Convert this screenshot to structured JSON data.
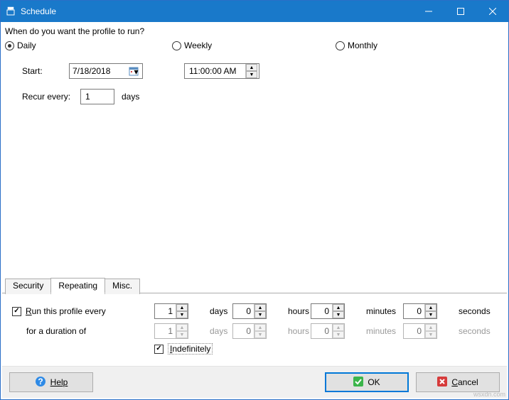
{
  "window": {
    "title": "Schedule"
  },
  "question": "When do you want the profile to run?",
  "frequency": {
    "daily": "Daily",
    "weekly": "Weekly",
    "monthly": "Monthly",
    "selected": "daily"
  },
  "start": {
    "label": "Start:",
    "date": "7/18/2018",
    "time": "11:00:00 AM"
  },
  "recur": {
    "label": "Recur every:",
    "value": "1",
    "unit": "days"
  },
  "tabs": {
    "security": "Security",
    "repeating": "Repeating",
    "misc": "Misc.",
    "active": "repeating"
  },
  "repeat": {
    "run_label": "Run this profile every",
    "duration_label": "for a duration of",
    "indefinitely": "Indefinitely",
    "units": {
      "days": "days",
      "hours": "hours",
      "minutes": "minutes",
      "seconds": "seconds"
    },
    "every": {
      "days": "1",
      "hours": "0",
      "minutes": "0",
      "seconds": "0"
    },
    "duration": {
      "days": "1",
      "hours": "0",
      "minutes": "0",
      "seconds": "0"
    }
  },
  "buttons": {
    "help": "Help",
    "ok": "OK",
    "cancel": "Cancel"
  },
  "watermark": "wsxdn.com"
}
